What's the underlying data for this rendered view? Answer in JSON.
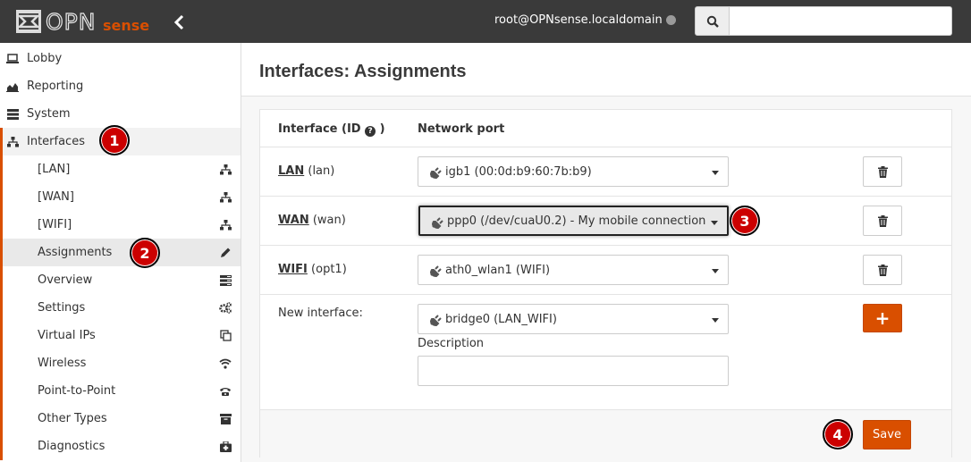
{
  "header": {
    "logo_text": "OPNsense",
    "user": "root@OPNsense.localdomain",
    "search": {
      "placeholder": "",
      "value": ""
    }
  },
  "sidebar": {
    "items": [
      {
        "label": "Lobby",
        "icon": "laptop-icon"
      },
      {
        "label": "Reporting",
        "icon": "area-chart-icon"
      },
      {
        "label": "System",
        "icon": "server-icon"
      },
      {
        "label": "Interfaces",
        "icon": "sitemap-icon",
        "active": true
      }
    ],
    "subitems": [
      {
        "label": "[LAN]",
        "icon": "sitemap-icon"
      },
      {
        "label": "[WAN]",
        "icon": "sitemap-icon"
      },
      {
        "label": "[WIFI]",
        "icon": "sitemap-icon"
      },
      {
        "label": "Assignments",
        "icon": "pencil-icon",
        "selected": true
      },
      {
        "label": "Overview",
        "icon": "tasks-icon"
      },
      {
        "label": "Settings",
        "icon": "cogs-icon"
      },
      {
        "label": "Virtual IPs",
        "icon": "clone-icon"
      },
      {
        "label": "Wireless",
        "icon": "wifi-icon"
      },
      {
        "label": "Point-to-Point",
        "icon": "phone-icon"
      },
      {
        "label": "Other Types",
        "icon": "archive-icon"
      },
      {
        "label": "Diagnostics",
        "icon": "medkit-icon"
      }
    ]
  },
  "page": {
    "title": "Interfaces: Assignments"
  },
  "table": {
    "col_interface": "Interface (ID",
    "col_interface_end": ")",
    "col_port": "Network port",
    "rows": [
      {
        "name": "LAN",
        "id": "(lan)",
        "port": "igb1 (00:0d:b9:60:7b:b9)"
      },
      {
        "name": "WAN",
        "id": "(wan)",
        "port": "ppp0 (/dev/cuaU0.2) - My mobile connection"
      },
      {
        "name": "WIFI",
        "id": "(opt1)",
        "port": "ath0_wlan1 (WIFI)"
      }
    ],
    "new_interface_label": "New interface:",
    "new_interface_port": "bridge0 (LAN_WIFI)",
    "description_label": "Description",
    "description_value": "",
    "add_label": "+",
    "save_label": "Save"
  },
  "badges": [
    "1",
    "2",
    "3",
    "4"
  ],
  "colors": {
    "accent": "#d94f00",
    "badge": "#cc0000",
    "topbar": "#3a3a3a"
  }
}
